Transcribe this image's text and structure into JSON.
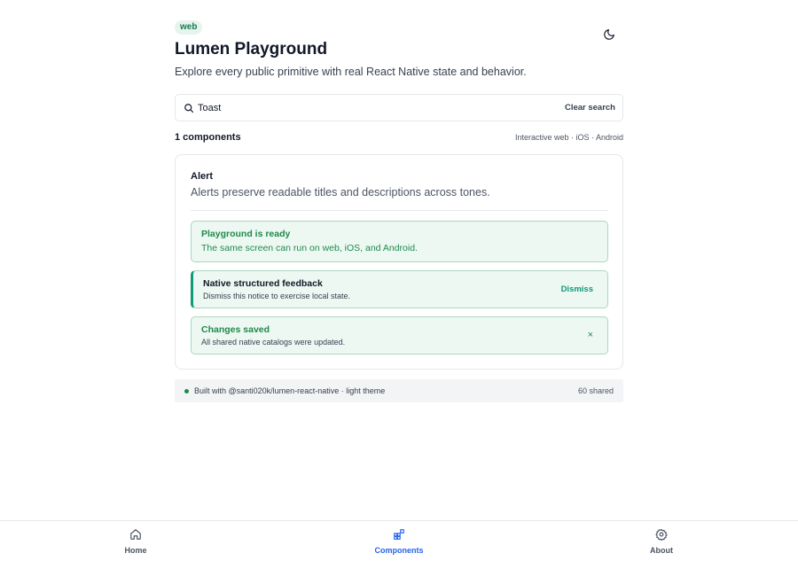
{
  "header": {
    "platform_badge": "web",
    "title": "Lumen Playground",
    "subtitle": "Explore every public primitive with real React Native state and behavior.",
    "theme_icon": "moon-icon"
  },
  "search": {
    "value": "Toast",
    "clear_label": "Clear search"
  },
  "results": {
    "count_label": "1 components",
    "platforms_note": "Interactive web · iOS · Android"
  },
  "card": {
    "title": "Alert",
    "description": "Alerts preserve readable titles and descriptions across tones.",
    "alerts": [
      {
        "title": "Playground is ready",
        "body": "The same screen can run on web, iOS, and Android."
      },
      {
        "title": "Native structured feedback",
        "body": "Dismiss this notice to exercise local state.",
        "action_label": "Dismiss"
      },
      {
        "title": "Changes saved",
        "body": "All shared native catalogs were updated.",
        "close_label": "×"
      }
    ]
  },
  "footer": {
    "text": "Built with @santi020k/lumen-react-native · light theme",
    "count": "60 shared"
  },
  "tabs": [
    {
      "label": "Home",
      "icon": "home-icon",
      "active": false
    },
    {
      "label": "Components",
      "icon": "grid-icon",
      "active": true
    },
    {
      "label": "About",
      "icon": "gear-icon",
      "active": false
    }
  ],
  "colors": {
    "accent": "#2563eb",
    "success": "#1f8a4c",
    "success_bg": "#edf8f2",
    "teal": "#0f9a7a"
  }
}
